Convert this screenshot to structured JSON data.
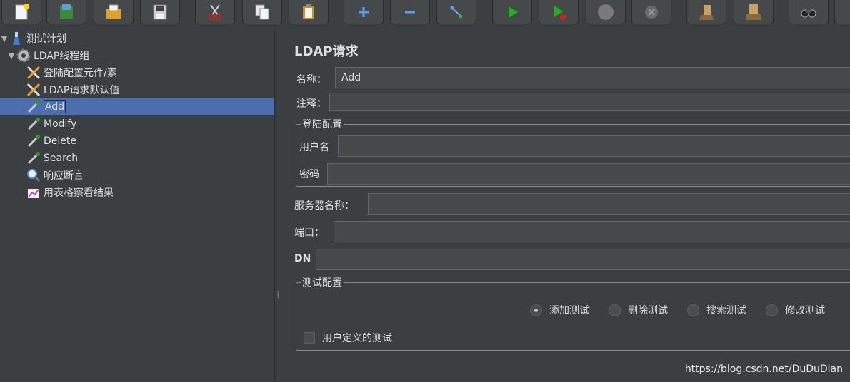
{
  "toolbar": {
    "buttons": [
      {
        "icon": "new-document-icon"
      },
      {
        "icon": "templates-icon"
      },
      {
        "icon": "open-folder-icon"
      },
      {
        "icon": "save-icon"
      },
      {
        "icon": "cut-icon"
      },
      {
        "icon": "copy-icon"
      },
      {
        "icon": "paste-icon"
      },
      {
        "icon": "expand-icon"
      },
      {
        "icon": "collapse-icon"
      },
      {
        "icon": "toggle-icon"
      },
      {
        "icon": "start-icon"
      },
      {
        "icon": "start-no-pauses-icon"
      },
      {
        "icon": "stop-icon"
      },
      {
        "icon": "shutdown-icon"
      },
      {
        "icon": "clear-icon"
      },
      {
        "icon": "clear-all-icon"
      },
      {
        "icon": "search-icon"
      }
    ]
  },
  "tree": {
    "items": [
      {
        "label": "测试计划"
      },
      {
        "label": "LDAP线程组"
      },
      {
        "label": "登陆配置元件/素"
      },
      {
        "label": "LDAP请求默认值"
      },
      {
        "label": "Add"
      },
      {
        "label": "Modify"
      },
      {
        "label": "Delete"
      },
      {
        "label": "Search"
      },
      {
        "label": "响应断言"
      },
      {
        "label": "用表格察看结果"
      }
    ]
  },
  "panel": {
    "title": "LDAP请求",
    "name_label": "名称：",
    "name_value": "Add",
    "comment_label": "注释：",
    "login_group": {
      "title": "登陆配置",
      "username_label": "用户名",
      "password_label": "密码"
    },
    "server_label": "服务器名称：",
    "port_label": "端口：",
    "dn_label": "DN",
    "test_group": {
      "title": "测试配置",
      "options": [
        "添加测试",
        "删除测试",
        "搜索测试",
        "修改测试"
      ],
      "selected": "添加测试",
      "user_defined_label": "用户定义的测试"
    }
  },
  "watermark": "https://blog.csdn.net/DuDuDian",
  "colors": {
    "background": "#3c3f41",
    "selection": "#4b6eaf",
    "field": "#45494a",
    "text": "#dfdfdf"
  }
}
